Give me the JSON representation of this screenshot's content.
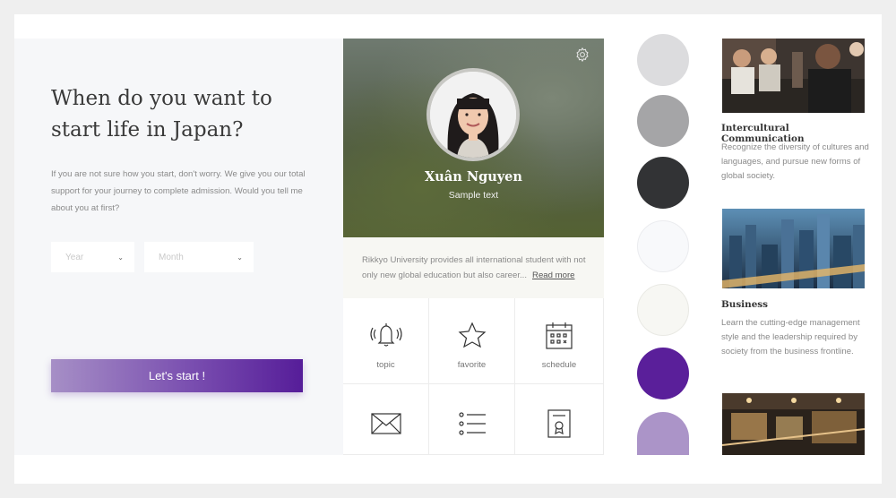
{
  "left": {
    "headline": "When do you want to start life in Japan?",
    "intro": "If you are not sure how you start, don't worry. We give you our total support for your journey to complete admission. Would you tell me about you at first?",
    "year_placeholder": "Year",
    "month_placeholder": "Month",
    "start_button": "Let's start !"
  },
  "profile": {
    "name": "Xuân Nguyen",
    "subtitle": "Sample text",
    "info_text": "Rikkyo University provides all international student with not only new global education but also career...",
    "read_more": "Read more"
  },
  "menu": [
    {
      "label": "topic",
      "icon": "bell-icon"
    },
    {
      "label": "favorite",
      "icon": "star-icon"
    },
    {
      "label": "schedule",
      "icon": "calendar-icon"
    },
    {
      "label": "",
      "icon": "mail-icon"
    },
    {
      "label": "",
      "icon": "list-icon"
    },
    {
      "label": "",
      "icon": "certificate-icon"
    }
  ],
  "swatches": [
    "#dcdcde",
    "#a5a5a7",
    "#323335",
    "#f8f9fb",
    "#f7f7f3",
    "#5a1f9a",
    "#ab94c8"
  ],
  "cards": [
    {
      "title": "Intercultural Communication",
      "description": "Recognize the diversity of cultures and languages, and pursue new forms of global society."
    },
    {
      "title": "Business",
      "description": "Learn the cutting-edge management style and the leadership required by society from the business frontline."
    },
    {
      "title": "",
      "description": ""
    }
  ],
  "colors": {
    "accent_purple": "#5a1f9a",
    "accent_light_purple": "#a68fc6"
  }
}
